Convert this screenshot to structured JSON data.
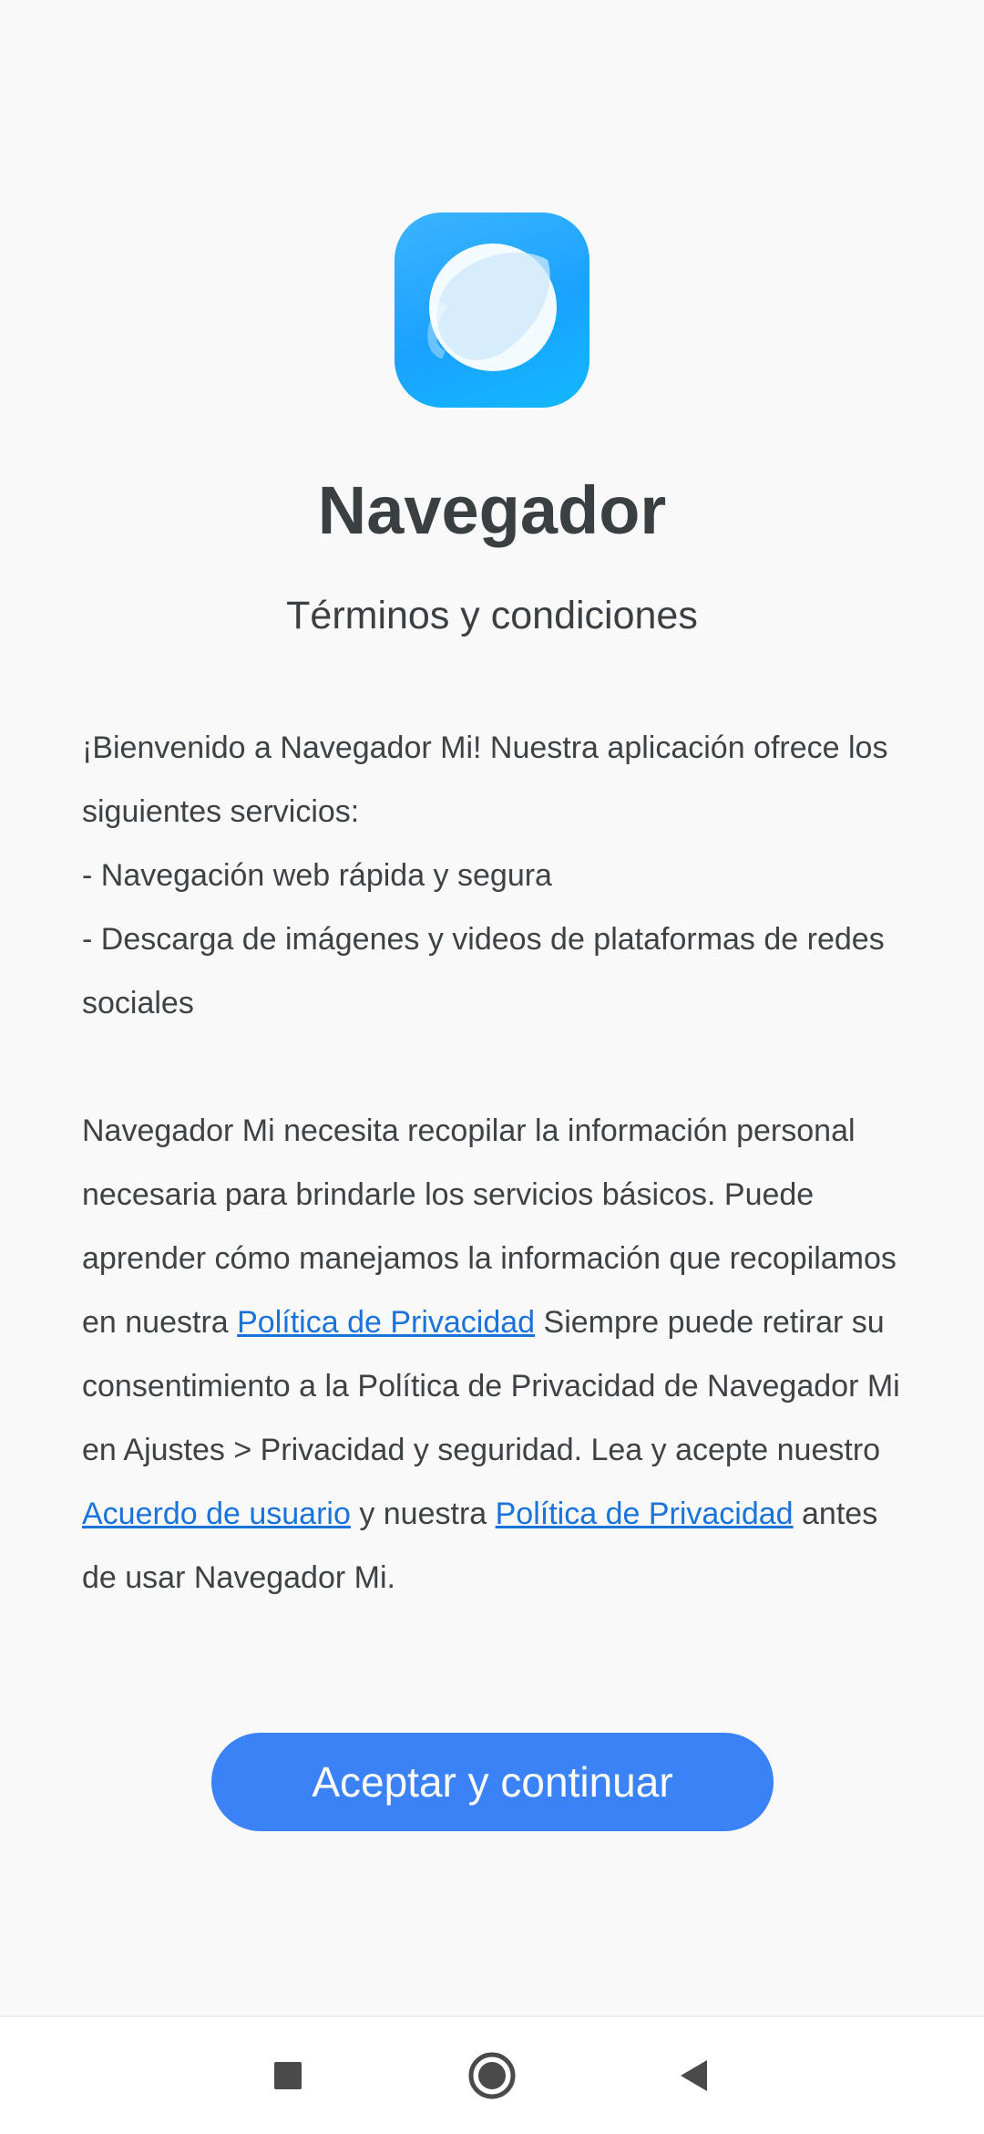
{
  "app": {
    "name": "Navegador",
    "subtitle": "Términos y condiciones"
  },
  "intro": {
    "welcome": "¡Bienvenido a Navegador Mi! Nuestra aplicación ofrece los siguientes servicios:",
    "service_1": "- Navegación web rápida y segura",
    "service_2": "- Descarga de imágenes y videos de plataformas de redes sociales"
  },
  "consent": {
    "part_1": "Navegador Mi necesita recopilar la información personal necesaria para brindarle los servicios básicos. Puede aprender cómo manejamos la información que recopilamos en nuestra ",
    "privacy_link_1": "Política de Privacidad",
    "part_2": " Siempre puede retirar su consentimiento a la Política de Privacidad de Navegador Mi en Ajustes > Privacidad y seguridad. Lea y acepte nuestro ",
    "user_agreement_link": "Acuerdo de usuario",
    "part_3": " y nuestra ",
    "privacy_link_2": "Política de Privacidad",
    "part_4": " antes de usar Navegador Mi."
  },
  "actions": {
    "accept_label": "Aceptar y continuar"
  },
  "nav_bar": {
    "recents_icon": "square-icon",
    "home_icon": "circle-icon",
    "back_icon": "triangle-back-icon"
  },
  "colors": {
    "accent": "#3a82f6",
    "link": "#1a73d9",
    "icon_blue": "#1aa2ff"
  }
}
